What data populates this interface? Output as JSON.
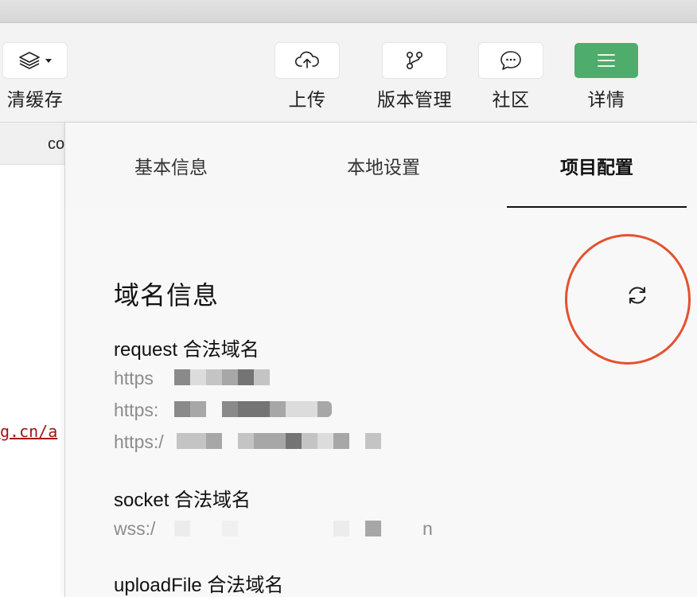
{
  "toolbar": {
    "clear_cache_label": "清缓存",
    "upload_label": "上传",
    "version_label": "版本管理",
    "community_label": "社区",
    "detail_label": "详情",
    "icons": {
      "clear_cache": "layers-icon",
      "upload": "cloud-upload-icon",
      "version": "git-branch-icon",
      "community": "chat-bubble-icon",
      "detail": "menu-icon"
    },
    "detail_button_color": "#4eac6d"
  },
  "editor": {
    "tab_text": "co",
    "code_snippet": "g.cn/a"
  },
  "panel": {
    "tabs": [
      {
        "label": "基本信息"
      },
      {
        "label": "本地设置"
      },
      {
        "label": "项目配置"
      }
    ],
    "active_tab": "项目配置",
    "section_title": "域名信息",
    "refresh_icon": "refresh-icon",
    "highlight_color": "#e5512d",
    "groups": [
      {
        "title": "request 合法域名",
        "domains": [
          "https",
          "https:",
          "https:/"
        ]
      },
      {
        "title": "socket 合法域名",
        "domains": [
          "wss:/"
        ],
        "suffix": "n"
      },
      {
        "title": "uploadFile 合法域名",
        "domains": []
      }
    ]
  }
}
